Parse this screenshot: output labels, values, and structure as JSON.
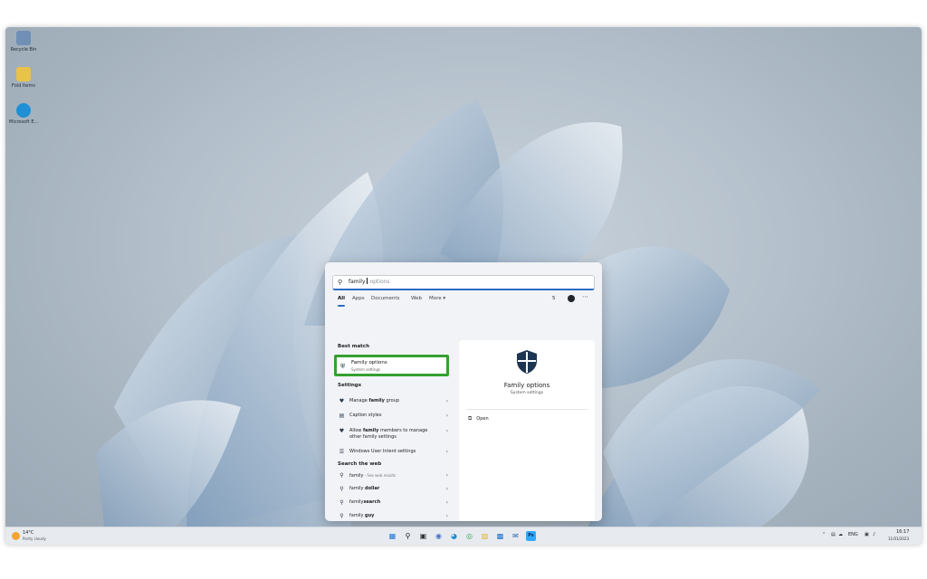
{
  "desktop": {
    "icons": [
      {
        "label": "Recycle Bin",
        "icon": "recycle-bin-icon",
        "color": "#6f8fb5"
      },
      {
        "label": "Fold Items",
        "icon": "folder-icon",
        "color": "#e8c24a"
      },
      {
        "label": "Microsoft E...",
        "icon": "edge-icon",
        "color": "#1f8fd6"
      }
    ]
  },
  "search": {
    "query_typed": "family",
    "query_suggest": " options",
    "tabs": [
      "All",
      "Apps",
      "Documents",
      "Web",
      "More ▾"
    ],
    "points": "5",
    "best_match_header": "Best match",
    "best_match": {
      "title": "Family options",
      "subtitle": "System settings"
    },
    "settings_header": "Settings",
    "settings": [
      {
        "bold": "",
        "pre": "Manage ",
        "mid": "family",
        "post": " group"
      },
      {
        "bold": "",
        "pre": "Caption styles",
        "mid": "",
        "post": ""
      },
      {
        "bold": "",
        "pre": "Allow ",
        "mid": "family",
        "post": " members to manage other family settings"
      },
      {
        "bold": "",
        "pre": "Windows User Intent settings",
        "mid": "",
        "post": ""
      }
    ],
    "web_header": "Search the web",
    "web": [
      {
        "pre": "family",
        "sub": " - See web results"
      },
      {
        "pre": "family ",
        "mid": "dollar"
      },
      {
        "pre": "family",
        "mid": "search"
      },
      {
        "pre": "family ",
        "mid": "guy"
      }
    ],
    "preview": {
      "title": "Family options",
      "subtitle": "System settings",
      "open_label": "Open"
    }
  },
  "taskbar": {
    "weather_temp": "14°C",
    "weather_desc": "Partly cloudy",
    "tray_lang": "ENG",
    "time": "16:17",
    "date": "11/01/2023"
  },
  "colors": {
    "accent": "#2b6cc4",
    "highlight_box": "#34a02f"
  }
}
